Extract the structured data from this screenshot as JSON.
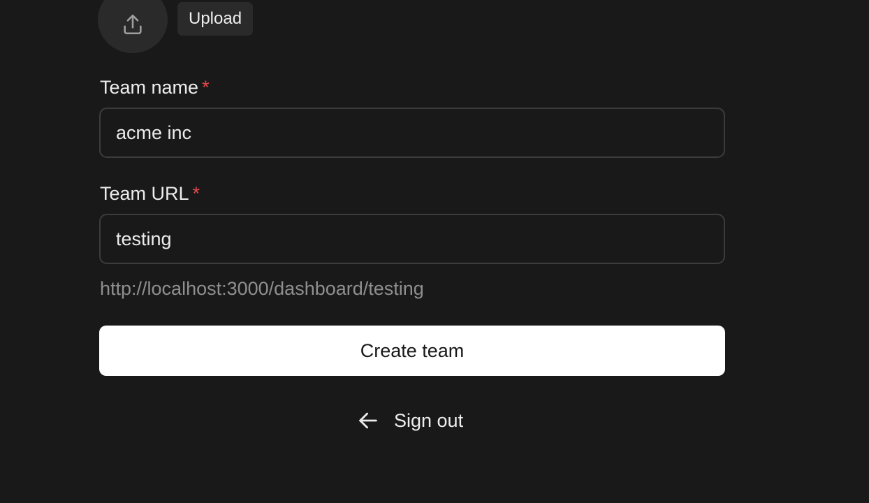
{
  "avatar": {
    "icon": "upload-icon",
    "upload_label": "Upload"
  },
  "form": {
    "team_name": {
      "label": "Team name",
      "required_mark": "*",
      "value": "acme inc"
    },
    "team_url": {
      "label": "Team URL",
      "required_mark": "*",
      "value": "testing",
      "preview": "http://localhost:3000/dashboard/testing"
    },
    "submit_label": "Create team"
  },
  "footer": {
    "signout_icon": "arrow-left-icon",
    "signout_label": "Sign out"
  },
  "colors": {
    "background": "#191919",
    "required": "#e5484d",
    "primary_button": "#ffffff"
  }
}
